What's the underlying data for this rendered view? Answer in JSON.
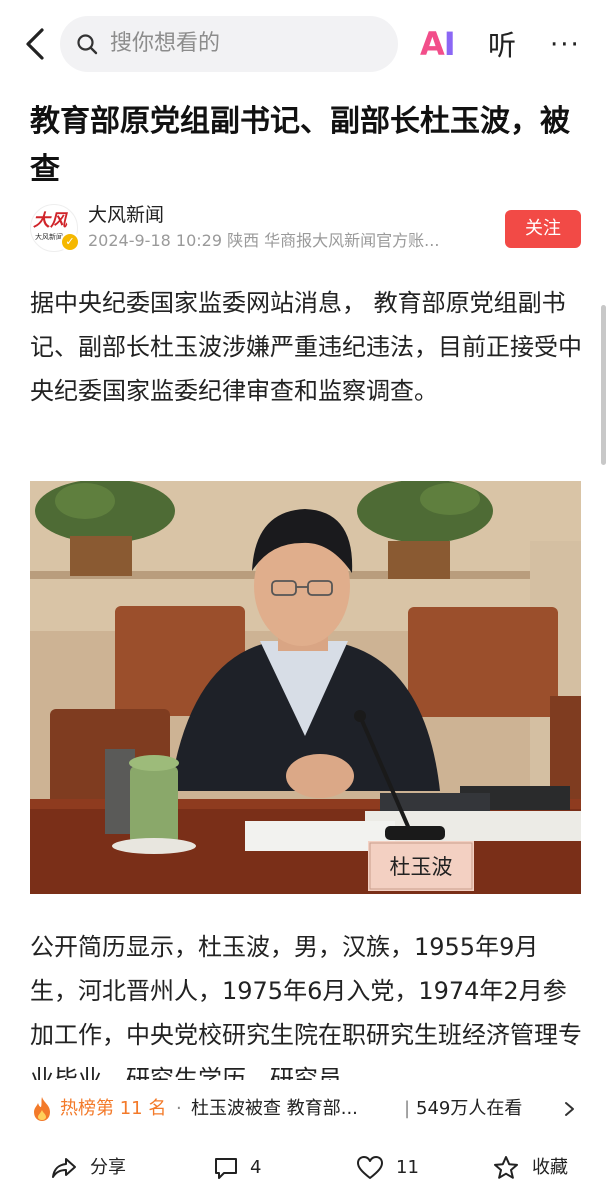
{
  "header": {
    "search_placeholder": "搜你想看的",
    "ai_label_a": "A",
    "ai_label_i": "I",
    "listen_label": "听",
    "more_label": "···"
  },
  "article": {
    "title": "教育部原党组副书记、副部长杜玉波，被查",
    "author": {
      "name": "大风新闻",
      "logo_text": "大风",
      "logo_sub": "大风新闻",
      "meta": "2024-9-18  10:29  陕西  华商报大风新闻官方账...",
      "follow_label": "关注"
    },
    "paragraph1": "据中央纪委国家监委网站消息， 教育部原党组副书记、副部长杜玉波涉嫌严重违纪违法，目前正接受中央纪委国家监委纪律审查和监察调查。",
    "photo": {
      "nameplate": "杜玉波"
    },
    "paragraph2": "公开简历显示，杜玉波，男，汉族，1955年9月生，河北晋州人，1975年6月入党，1974年2月参加工作，中央党校研究生院在职研究生班经济管理专业毕业，研究生学历，研究员"
  },
  "hot": {
    "rank": "热榜第 11 名",
    "dot": "·",
    "title": "杜玉波被查 教育部...",
    "separator": "|",
    "count": "549万人在看"
  },
  "actions": {
    "share": "分享",
    "comments": "4",
    "likes": "11",
    "favorite": "收藏"
  },
  "colors": {
    "accent_red": "#f24a46",
    "hot_orange": "#f37a2a"
  }
}
